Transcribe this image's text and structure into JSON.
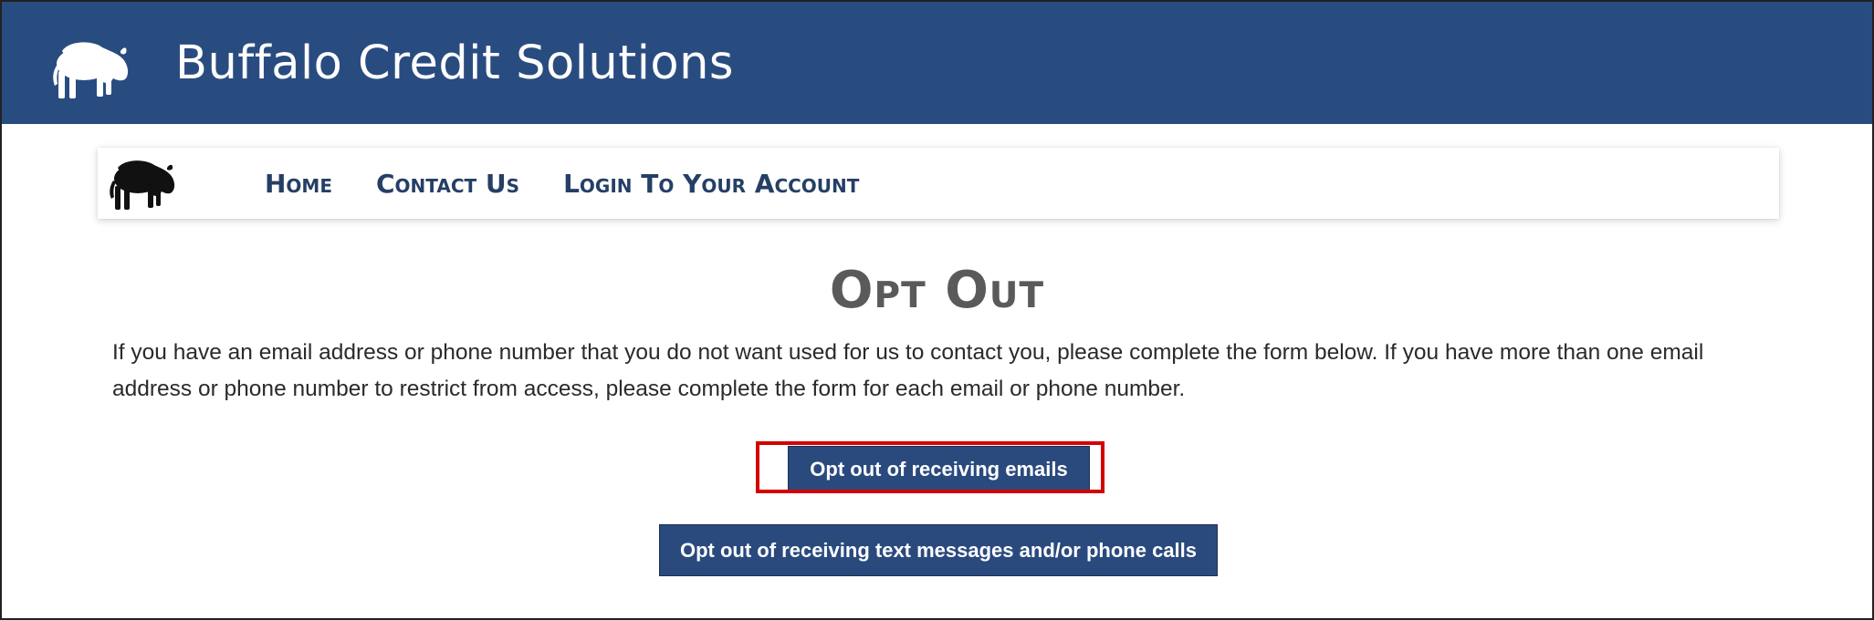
{
  "header": {
    "brand": "Buffalo Credit Solutions",
    "logo_icon": "buffalo-icon"
  },
  "nav": {
    "logo_icon": "buffalo-icon",
    "links": [
      {
        "label": "Home"
      },
      {
        "label": "Contact Us"
      },
      {
        "label": "Login To Your Account"
      }
    ]
  },
  "main": {
    "title": "Opt Out",
    "intro": "If you have an email address or phone number that you do not want used for us to contact you, please complete the form below. If you have more than one email address or phone number to restrict from access, please complete the form for each email or phone number.",
    "buttons": {
      "email": "Opt out of receiving emails",
      "text": "Opt out of receiving text messages and/or phone calls"
    }
  },
  "colors": {
    "header_bg": "#294c80",
    "button_bg": "#2a4a7e",
    "nav_text": "#253f66",
    "highlight": "#d40000"
  }
}
